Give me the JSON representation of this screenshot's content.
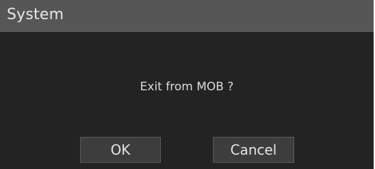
{
  "dialog": {
    "title": "System",
    "message": "Exit from MOB ?",
    "buttons": {
      "ok_label": "OK",
      "cancel_label": "Cancel"
    }
  },
  "colors": {
    "titlebar": "#565656",
    "body_background": "#232323",
    "button_background": "#3d3d3d",
    "text": "#e6e6e6"
  }
}
